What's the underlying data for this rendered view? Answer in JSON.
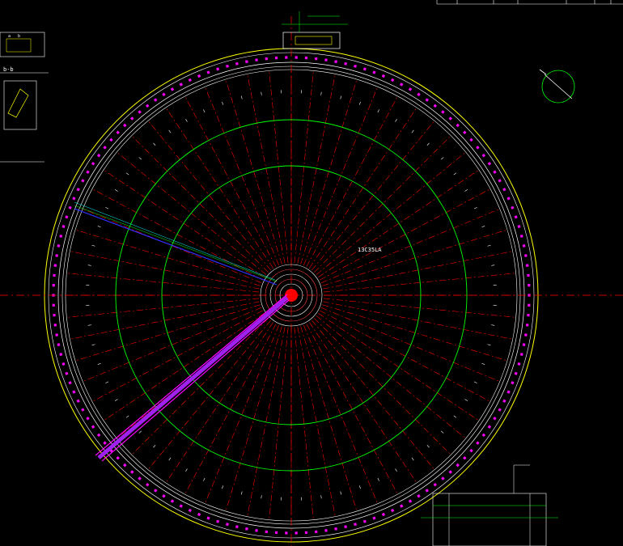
{
  "drawing": {
    "title_block_fields": [
      "",
      "",
      "",
      "",
      "",
      ""
    ],
    "section_label": "b-b",
    "left_detail_top_labels": [
      "a",
      "b"
    ],
    "center_label": "13C35LA",
    "colors": {
      "background": "#000000",
      "outer_ring": "#ffff00",
      "white_ring": "#ffffff",
      "magenta": "#ff00ff",
      "radial_red": "#ff0000",
      "green": "#00ff00",
      "blue": "#3030ff",
      "cyan": "#00ffff"
    },
    "radial_line_count": 64,
    "annotation_texts": [
      "",
      "",
      "",
      "",
      "",
      ""
    ]
  }
}
